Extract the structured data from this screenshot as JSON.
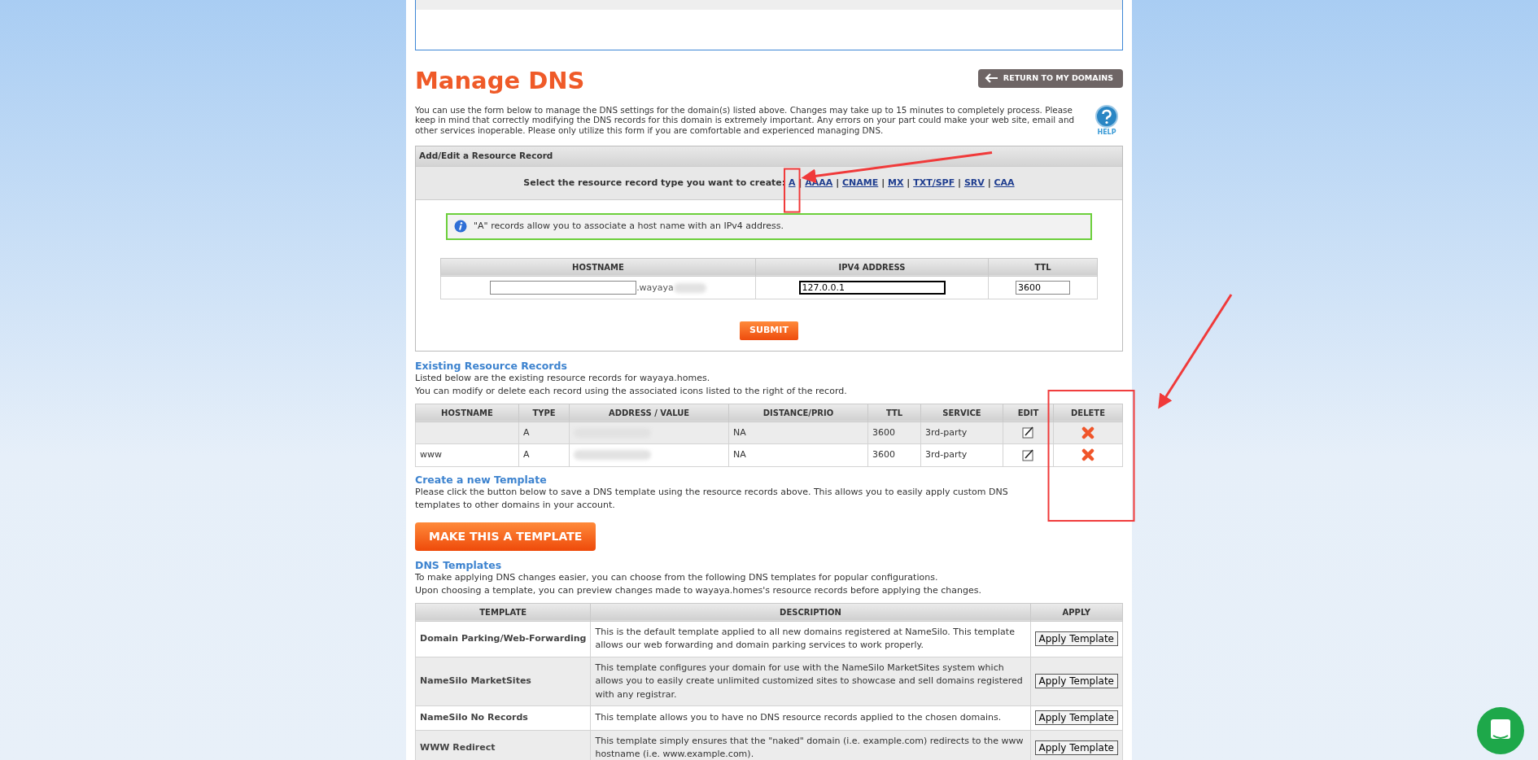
{
  "title": "Manage DNS",
  "return_button": "RETURN TO MY DOMAINS",
  "intro": "You can use the form below to manage the DNS settings for the domain(s) listed above. Changes may take up to 15 minutes to completely process. Please keep in mind that correctly modifying the DNS records for this domain is extremely important. Any errors on your part could make your web site, email and other services inoperable. Please only utilize this form if you are comfortable and experienced managing DNS.",
  "help_label": "HELP",
  "record_form": {
    "header": "Add/Edit a Resource Record",
    "prompt": "Select the resource record type you want to create:",
    "types": [
      "A",
      "AAAA",
      "CNAME",
      "MX",
      "TXT/SPF",
      "SRV",
      "CAA"
    ],
    "separator": "|",
    "info": "\"A\" records allow you to associate a host name with an IPv4 address.",
    "columns": [
      "HOSTNAME",
      "IPV4 ADDRESS",
      "TTL"
    ],
    "hostname_suffix": ".wayaya",
    "address_value": "127.0.0.1",
    "ttl_value": "3600",
    "submit": "SUBMIT"
  },
  "existing": {
    "title": "Existing Resource Records",
    "lines": [
      "Listed below are the existing resource records for wayaya.homes.",
      "You can modify or delete each record using the associated icons listed to the right of the record."
    ],
    "columns": [
      "HOSTNAME",
      "TYPE",
      "ADDRESS / VALUE",
      "DISTANCE/PRIO",
      "TTL",
      "SERVICE",
      "EDIT",
      "DELETE"
    ],
    "rows": [
      {
        "type": "A",
        "distance": "NA",
        "ttl": "3600",
        "service": "3rd-party"
      },
      {
        "hostname": "www",
        "type": "A",
        "distance": "NA",
        "ttl": "3600",
        "service": "3rd-party"
      }
    ]
  },
  "new_template": {
    "title": "Create a new Template",
    "text": "Please click the button below to save a DNS template using the resource records above. This allows you to easily apply custom DNS templates to other domains in your account.",
    "button": "MAKE THIS A TEMPLATE"
  },
  "templates": {
    "title": "DNS Templates",
    "lines": [
      "To make applying DNS changes easier, you can choose from the following DNS templates for popular configurations.",
      "Upon choosing a template, you can preview changes made to wayaya.homes's resource records before applying the changes."
    ],
    "columns": [
      "TEMPLATE",
      "DESCRIPTION",
      "APPLY"
    ],
    "rows": [
      {
        "name": "Domain Parking/Web-Forwarding",
        "description": "This is the default template applied to all new domains registered at NameSilo. This template allows our web forwarding and domain parking services to work properly.",
        "button": "Apply Template"
      },
      {
        "name": "NameSilo MarketSites",
        "description": "This template configures your domain for use with the NameSilo MarketSites system which allows you to easily create unlimited customized sites to showcase and sell domains registered with any registrar.",
        "button": "Apply Template"
      },
      {
        "name": "NameSilo No Records",
        "description": "This template allows you to have no DNS resource records applied to the chosen domains.",
        "button": "Apply Template"
      },
      {
        "name": "WWW Redirect",
        "description": "This template simply ensures that the \"naked\" domain (i.e. example.com) redirects to the www hostname (i.e. www.example.com).",
        "button": "Apply Template"
      }
    ]
  }
}
